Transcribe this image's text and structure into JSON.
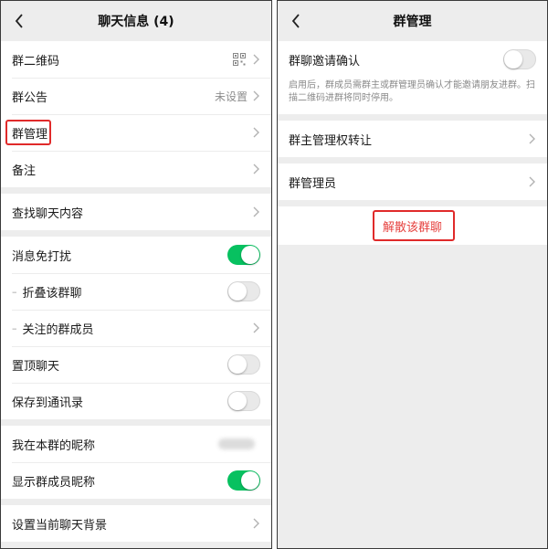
{
  "left": {
    "title": "聊天信息 (4)",
    "rows": [
      {
        "label": "群二维码"
      },
      {
        "label": "群公告",
        "value": "未设置"
      },
      {
        "label": "群管理"
      },
      {
        "label": "备注"
      },
      {
        "label": "查找聊天内容"
      },
      {
        "label": "消息免打扰",
        "toggle": true
      },
      {
        "label": "折叠该群聊",
        "toggle": false
      },
      {
        "label": "关注的群成员"
      },
      {
        "label": "置顶聊天",
        "toggle": false
      },
      {
        "label": "保存到通讯录",
        "toggle": false
      },
      {
        "label": "我在本群的昵称"
      },
      {
        "label": "显示群成员昵称",
        "toggle": true
      },
      {
        "label": "设置当前聊天背景"
      }
    ]
  },
  "right": {
    "title": "群管理",
    "invite_confirm_label": "群聊邀请确认",
    "invite_confirm_on": false,
    "invite_confirm_desc": "启用后，群成员需群主或群管理员确认才能邀请朋友进群。扫描二维码进群将同时停用。",
    "transfer_owner_label": "群主管理权转让",
    "admins_label": "群管理员",
    "dissolve_label": "解散该群聊"
  },
  "colors": {
    "accent_green": "#07c160",
    "danger_red": "#e64340",
    "highlight_red": "#e02a2a"
  }
}
